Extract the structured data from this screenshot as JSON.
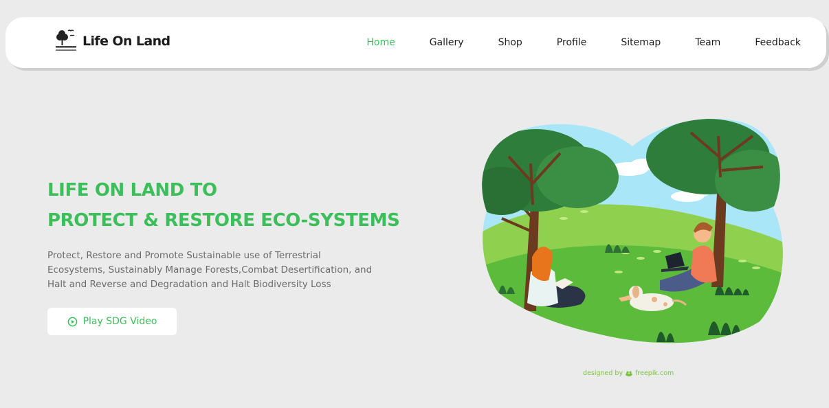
{
  "brand": {
    "name": "Life On Land",
    "logo_icon": "tree-with-birds-icon"
  },
  "nav": {
    "items": [
      {
        "label": "Home",
        "active": true
      },
      {
        "label": "Gallery",
        "active": false
      },
      {
        "label": "Shop",
        "active": false
      },
      {
        "label": "Profile",
        "active": false
      },
      {
        "label": "Sitemap",
        "active": false
      },
      {
        "label": "Team",
        "active": false
      },
      {
        "label": "Feedback",
        "active": false
      }
    ]
  },
  "hero": {
    "title_line1": "LIFE ON LAND TO",
    "title_line2": "PROTECT & RESTORE ECO-SYSTEMS",
    "description": "Protect, Restore and Promote Sustainable use of Terrestrial Ecosystems, Sustainably Manage Forests,Combat Desertification, and Halt and Reverse and Degradation and Halt Biodiversity Loss",
    "button_label": "Play SDG Video",
    "button_icon": "play-circle-icon"
  },
  "credit": {
    "prefix": "designed by",
    "brand": "freepik.com",
    "icon": "freepik-icon"
  },
  "colors": {
    "accent": "#3cbf5a",
    "background": "#ebebeb",
    "text_muted": "#6b6b6b",
    "nav_text": "#222222"
  }
}
